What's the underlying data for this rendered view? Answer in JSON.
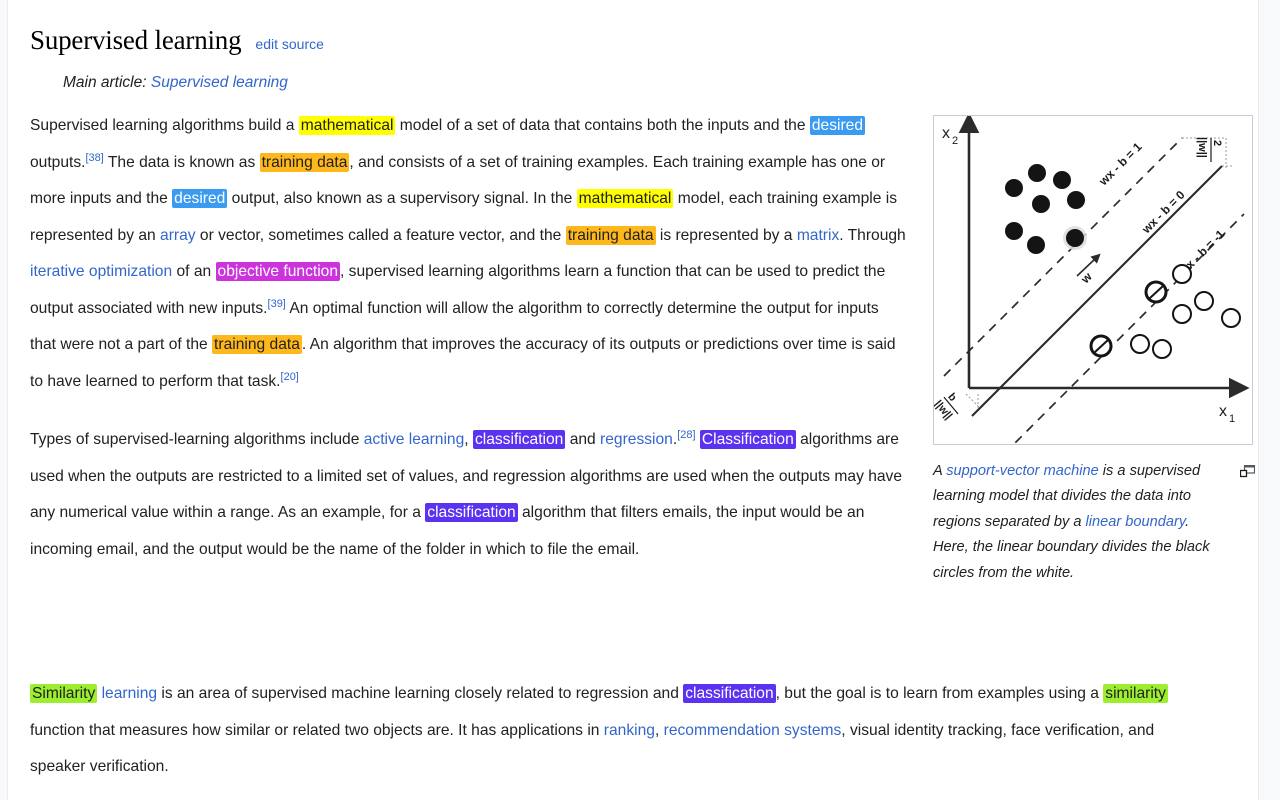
{
  "section": {
    "title": "Supervised learning",
    "edit_label": "edit source",
    "hatnote_prefix": "Main article:",
    "hatnote_link": "Supervised learning"
  },
  "paragraphs": {
    "p1": {
      "t1": "Supervised learning algorithms build a ",
      "hl_mathematical_1": "mathematical",
      "t2": " model of a set of data that contains both the inputs and the ",
      "hl_desired_1": "desired",
      "t3": " outputs.",
      "ref_38": "[38]",
      "t4": " The data is known as ",
      "hl_training_1": "training data",
      "t5": ", and consists of a set of training examples. Each training example has one or more inputs and the ",
      "hl_desired_2": "desired",
      "t6": " output, also known as a supervisory signal. In the ",
      "hl_mathematical_2": "mathematical",
      "t7": " model, each training example is represented by an ",
      "link_array": "array",
      "t8": " or vector, sometimes called a feature vector, and the ",
      "hl_training_2": "training data",
      "t9": " is represented by a ",
      "link_matrix": "matrix",
      "t10": ". Through ",
      "link_iterative": "iterative optimization",
      "t11": " of an ",
      "hl_objective": "objective function",
      "t12": ", supervised learning algorithms learn a function that can be used to predict the output associated with new inputs.",
      "ref_39": "[39]",
      "t13": " An optimal function will allow the algorithm to correctly determine the output for inputs that were not a part of the ",
      "hl_training_3": "training data",
      "t14": ". An algorithm that improves the accuracy of its outputs or predictions over time is said to have learned to perform that task.",
      "ref_20": "[20]"
    },
    "p2": {
      "t1": "Types of supervised-learning algorithms include ",
      "link_active": "active learning",
      "t2": ", ",
      "hl_classification_1": "classification",
      "t3": " and ",
      "link_regression": "regression",
      "t4": ".",
      "ref_28": "[28]",
      "t5": " ",
      "hl_classification_2": "Classification",
      "t6": " algorithms are used when the outputs are restricted to a limited set of values, and regression algorithms are used when the outputs may have any numerical value within a range. As an example, for a ",
      "hl_classification_3": "classification",
      "t7": " algorithm that filters emails, the input would be an incoming email, and the output would be the name of the folder in which to file the email."
    },
    "p3": {
      "hl_similarity_1": "Similarity",
      "t1": " ",
      "link_learning": "learning",
      "t2": " is an area of supervised machine learning closely related to regression and ",
      "hl_classification_4": "classification",
      "t3": ", but the goal is to learn from examples using a ",
      "hl_similarity_2": "similarity",
      "t4": " function that measures how similar or related two objects are. It has applications in ",
      "link_ranking": "ranking",
      "t5": ", ",
      "link_recsys": "recommendation systems",
      "t6": ", visual identity tracking, face verification, and speaker verification."
    }
  },
  "figure": {
    "axis_x_label": "x",
    "axis_x_sub": "1",
    "axis_y_label": "x",
    "axis_y_sub": "2",
    "line_label_upper": "wx - b = 1",
    "line_label_middle": "wx - b = 0",
    "line_label_lower": "wx - b = -1",
    "margin_label_top_num": "2",
    "margin_label_top_den": "||w||",
    "margin_label_bottom_num": "b",
    "margin_label_bottom_den": "||w||",
    "vector_label": "w",
    "caption": {
      "t1": "A ",
      "link_svm": "support-vector machine",
      "t2": " is a supervised learning model that divides the data into regions separated by a ",
      "link_boundary": "linear boundary",
      "t3": ". Here, the linear boundary divides the black circles from the white."
    },
    "enlarge_icon": "enlarge-icon"
  },
  "colors": {
    "link": "#3366cc",
    "highlight_yellow": "#ffff00",
    "highlight_orange": "#ffb81c",
    "highlight_blue": "#3b9bf0",
    "highlight_magenta": "#cc33dd",
    "highlight_violet": "#5b32f0",
    "highlight_green": "#9cee2e"
  }
}
